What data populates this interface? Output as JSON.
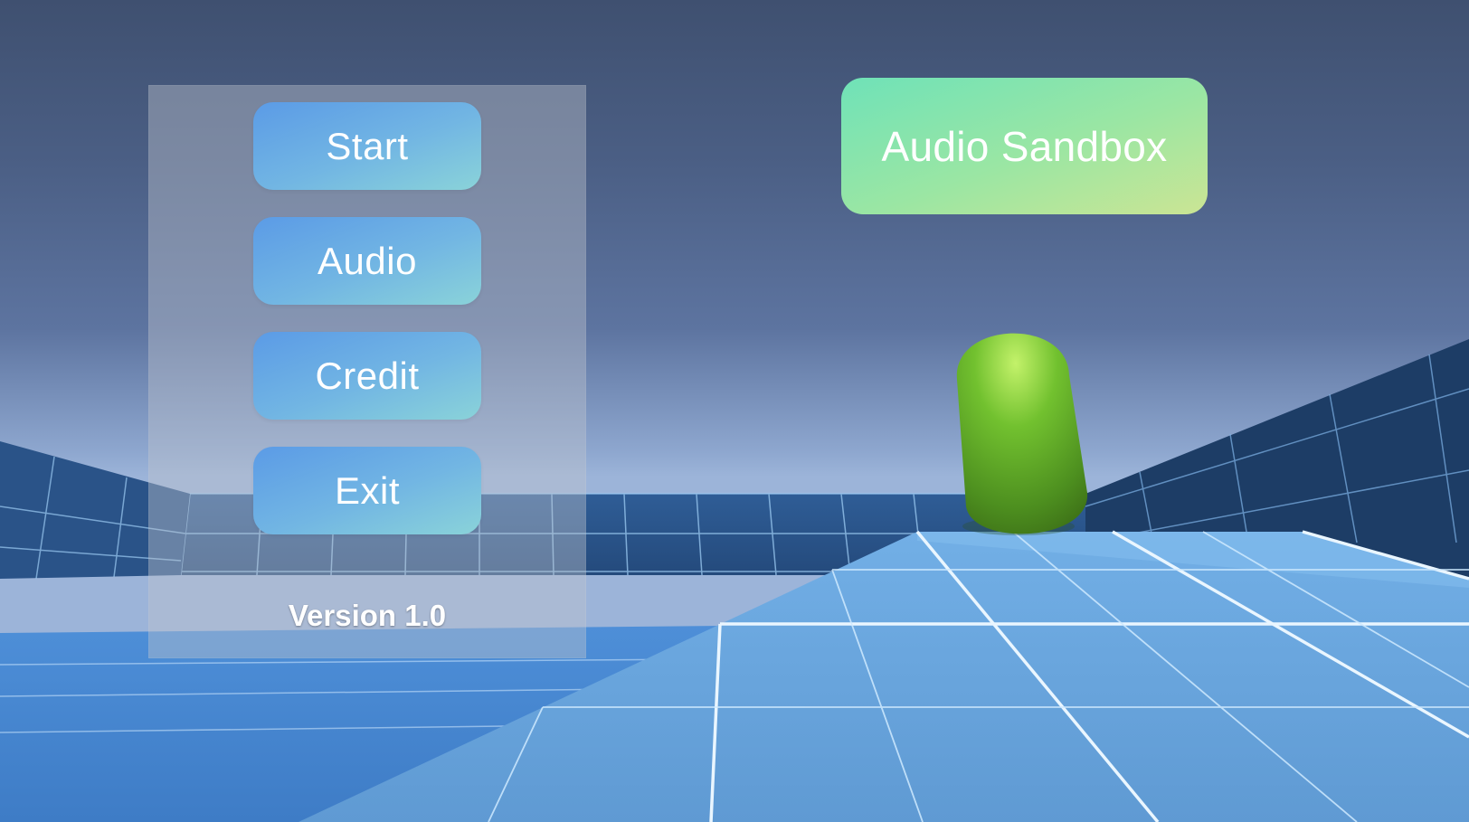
{
  "menu": {
    "buttons": [
      {
        "label": "Start"
      },
      {
        "label": "Audio"
      },
      {
        "label": "Credit"
      },
      {
        "label": "Exit"
      }
    ],
    "version": "Version 1.0"
  },
  "title": {
    "label": "Audio Sandbox"
  },
  "colors": {
    "button_gradient_start": "#5b9be6",
    "button_gradient_end": "#8ad3d9",
    "title_gradient_start": "#6fe2b8",
    "title_gradient_end": "#cbe594",
    "player_capsule": "#6fbf2e",
    "floor": "#6aa6dc",
    "grid_lines": "#eaf6ff"
  }
}
